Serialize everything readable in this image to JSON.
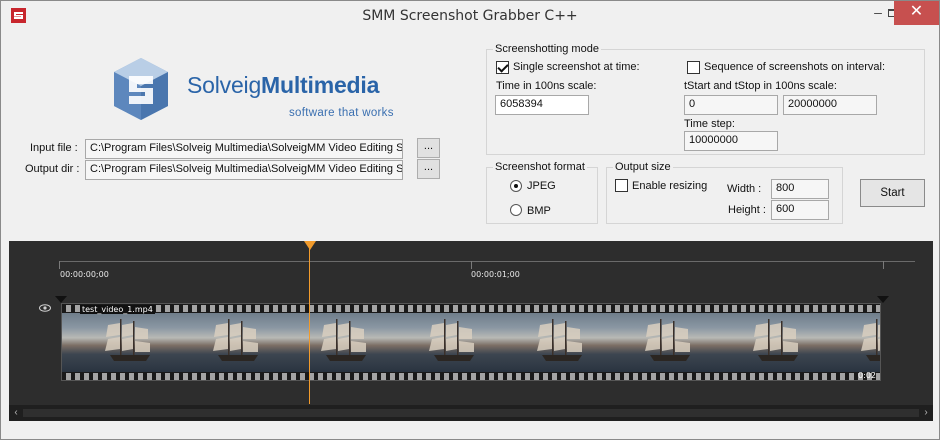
{
  "window": {
    "title": "SMM Screenshot Grabber C++",
    "minimize": "–",
    "close": "✕"
  },
  "logo": {
    "brand_light": "Solveig",
    "brand_bold": "Multimedia",
    "tagline": "software that works",
    "color": "#2a64a8"
  },
  "files": {
    "input_label": "Input file :",
    "input_value": "C:\\Program Files\\Solveig Multimedia\\SolveigMM Video Editing SDK",
    "output_label": "Output dir :",
    "output_value": "C:\\Program Files\\Solveig Multimedia\\SolveigMM Video Editing SDK",
    "browse_label": "..."
  },
  "mode": {
    "title": "Screenshotting mode",
    "single_label": "Single screenshot at time:",
    "single_checked": true,
    "time_label": "Time in 100ns scale:",
    "time_value": "6058394",
    "sequence_label": "Sequence of screenshots on interval:",
    "sequence_checked": false,
    "range_label": "tStart and tStop in 100ns scale:",
    "tstart_value": "0",
    "tstop_value": "20000000",
    "step_label": "Time step:",
    "step_value": "10000000"
  },
  "format": {
    "title": "Screenshot format",
    "options": [
      "JPEG",
      "BMP"
    ],
    "selected": "JPEG"
  },
  "output_size": {
    "title": "Output size",
    "resize_label": "Enable resizing",
    "resize_checked": false,
    "width_label": "Width :",
    "width_value": "800",
    "height_label": "Height :",
    "height_value": "600"
  },
  "start_label": "Start",
  "timeline": {
    "timecodes": [
      "00:00:00;00",
      "00:00:01;00"
    ],
    "clip_name": "test_video_1.mp4",
    "clip_duration": "0:02",
    "accent": "#f29b2c",
    "visibility_icon": "eye-icon"
  }
}
